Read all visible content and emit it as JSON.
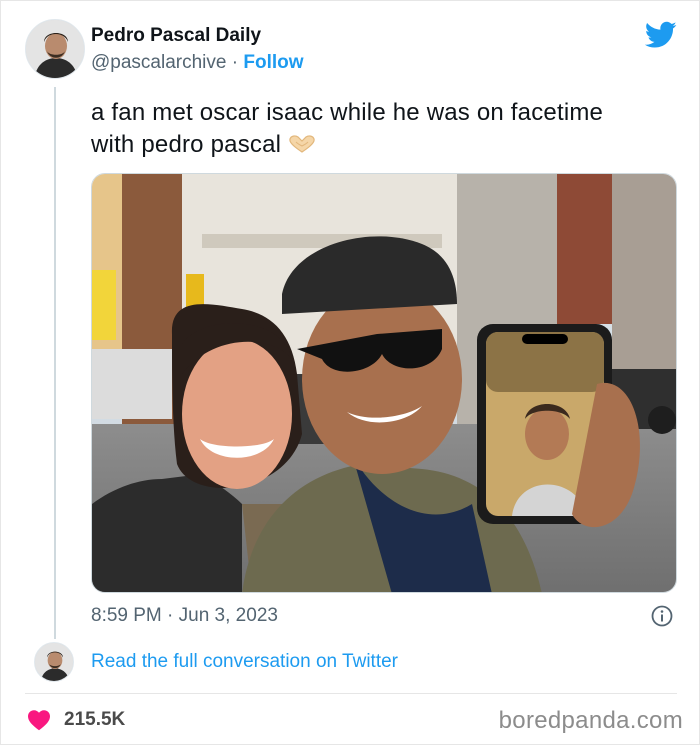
{
  "tweet": {
    "author_name": "Pedro Pascal Daily",
    "handle": "@pascalarchive",
    "separator": "·",
    "follow_label": "Follow",
    "text": "a fan met oscar isaac while he was on facetime with pedro pascal",
    "emoji_icon": "heart-hands-icon",
    "timestamp": "8:59 PM · Jun 3, 2023",
    "read_more_label": "Read the full conversation on Twitter",
    "likes_count": "215.5K"
  },
  "icons": {
    "brand": "twitter-bird-icon",
    "info": "info-icon",
    "like": "heart-icon"
  },
  "colors": {
    "twitter_blue": "#1d9bf0",
    "text_primary": "#0f1419",
    "text_secondary": "#536471",
    "heart": "#f91880",
    "watermark": "#8c8c8c"
  },
  "watermark": "boredpanda.com"
}
